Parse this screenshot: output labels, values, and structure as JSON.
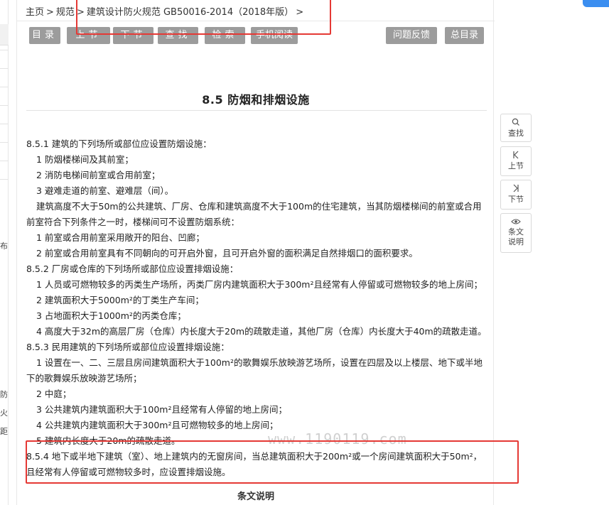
{
  "breadcrumb": {
    "items": [
      "主页",
      "规范",
      "建筑设计防火规范 GB50016-2014（2018年版）"
    ],
    "separator": ">"
  },
  "toolbar": {
    "buttons": [
      "目录",
      "上节",
      "下节",
      "查找",
      "检索",
      "手机阅读",
      "问题反馈",
      "总目录"
    ]
  },
  "section": {
    "title": "8.5 防烟和排烟设施"
  },
  "content": {
    "lines": [
      "8.5.1 建筑的下列场所或部位应设置防烟设施：",
      "1 防烟楼梯间及其前室；",
      "2 消防电梯间前室或合用前室；",
      "3 避难走道的前室、避难层（间）。",
      "建筑高度不大于50m的公共建筑、厂房、仓库和建筑高度不大于100m的住宅建筑，当其防烟楼梯间的前室或合用",
      "前室符合下列条件之一时，楼梯间可不设置防烟系统：",
      "1 前室或合用前室采用敞开的阳台、凹廊；",
      "2 前室或合用前室具有不同朝向的可开启外窗，且可开启外窗的面积满足自然排烟口的面积要求。",
      "8.5.2 厂房或仓库的下列场所或部位应设置排烟设施：",
      "1 人员或可燃物较多的丙类生产场所，丙类厂房内建筑面积大于300m²且经常有人停留或可燃物较多的地上房间；",
      "2 建筑面积大于5000m²的丁类生产车间；",
      "3 占地面积大于1000m²的丙类仓库；",
      "4 高度大于32m的高层厂房（仓库）内长度大于20m的疏散走道，其他厂房（仓库）内长度大于40m的疏散走道。",
      "8.5.3 民用建筑的下列场所或部位应设置排烟设施：",
      "1 设置在一、二、三层且房间建筑面积大于100m²的歌舞娱乐放映游艺场所，设置在四层及以上楼层、地下或半地",
      "下的歌舞娱乐放映游艺场所；",
      "2 中庭；",
      "3 公共建筑内建筑面积大于100m²且经常有人停留的地上房间；",
      "4 公共建筑内建筑面积大于300m²且可燃物较多的地上房间；",
      "5 建筑内长度大于20m的疏散走道。",
      "8.5.4 地下或半地下建筑（室）、地上建筑内的无窗房间，当总建筑面积大于200m²或一个房间建筑面积大于50m²，",
      "且经常有人停留或可燃物较多时，应设置排烟设施。"
    ],
    "notes_heading": "条文说明"
  },
  "watermark": "www.1190119.com",
  "side_nav": {
    "find": "查找",
    "prev": "上节",
    "next": "下节",
    "notes_line1": "条文",
    "notes_line2": "说明"
  },
  "left_fragments": [
    "布",
    "防",
    "火",
    "距"
  ],
  "colors": {
    "toolbar_button": "#9c9c9c",
    "annotation_red": "#e53935",
    "corner_accent": "#3b8ef0"
  }
}
